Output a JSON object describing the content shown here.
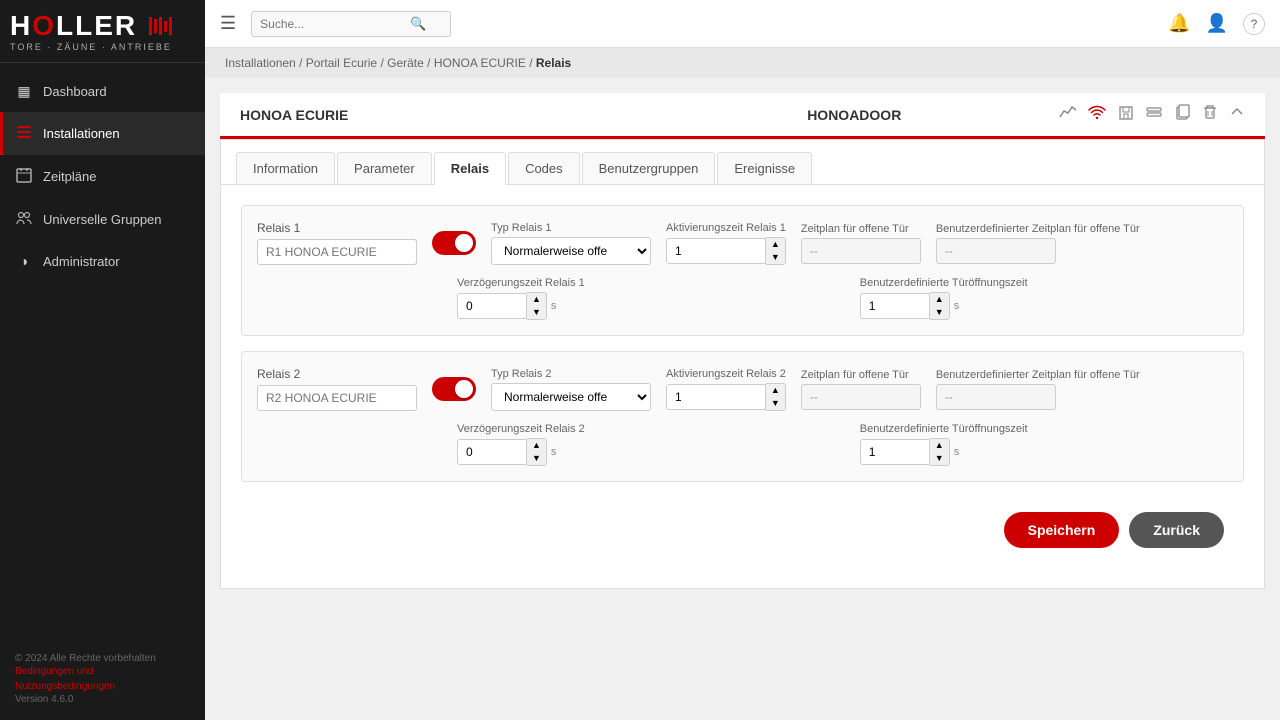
{
  "sidebar": {
    "logo_main": "HOLLER",
    "logo_sub": "TORE · ZÄUNE · ANTRIEBE",
    "nav_items": [
      {
        "id": "dashboard",
        "label": "Dashboard",
        "icon": "▦",
        "active": false
      },
      {
        "id": "installationen",
        "label": "Installationen",
        "icon": "☰",
        "active": true
      },
      {
        "id": "zeitplaene",
        "label": "Zeitpläne",
        "icon": "📅",
        "active": false
      },
      {
        "id": "universelle-gruppen",
        "label": "Universelle Gruppen",
        "icon": "👥",
        "active": false
      },
      {
        "id": "administrator",
        "label": "Administrator",
        "icon": "◑",
        "active": false
      }
    ],
    "footer": {
      "copyright": "© 2024 Alle Rechte vorbehalten",
      "terms_link": "Bedingungen und Nutzungsbedingungen",
      "version": "Version 4.6.0"
    }
  },
  "topbar": {
    "menu_icon": "☰",
    "search_placeholder": "Suche...",
    "icons": [
      "🔔",
      "👤",
      "?"
    ]
  },
  "breadcrumb": {
    "items": [
      "Installationen",
      "Portail Ecurie",
      "Geräte",
      "HONOA ECURIE"
    ],
    "current": "Relais"
  },
  "device": {
    "name_left": "HONOA ECURIE",
    "name_center": "HONOADOOR"
  },
  "tabs": [
    {
      "id": "information",
      "label": "Information",
      "active": false
    },
    {
      "id": "parameter",
      "label": "Parameter",
      "active": false
    },
    {
      "id": "relais",
      "label": "Relais",
      "active": true
    },
    {
      "id": "codes",
      "label": "Codes",
      "active": false
    },
    {
      "id": "benutzergruppen",
      "label": "Benutzergruppen",
      "active": false
    },
    {
      "id": "ereignisse",
      "label": "Ereignisse",
      "active": false
    }
  ],
  "relays": [
    {
      "id": "relay1",
      "title": "Relais 1",
      "name_placeholder": "R1 HONOA ECURIE",
      "toggle_on": true,
      "typ_label": "Typ Relais 1",
      "typ_value": "Normalerweise offe",
      "aktivierungszeit_label": "Aktivierungszeit Relais 1",
      "aktivierungszeit_value": "1",
      "zeitplan_label": "Zeitplan für offene Tür",
      "zeitplan_value": "--",
      "benutzerdef_zeitplan_label": "Benutzerdefinierter Zeitplan für offene Tür",
      "benutzerdef_zeitplan_value": "--",
      "verzoegerungszeit_label": "Verzögerungszeit Relais 1",
      "verzoegerungszeit_value": "0",
      "verzoegerungszeit_suffix": "s",
      "benutzerdef_oeffnungszeit_label": "Benutzerdefinierte Türöffnungszeit",
      "benutzerdef_oeffnungszeit_value": "1",
      "benutzerdef_oeffnungszeit_suffix": "s"
    },
    {
      "id": "relay2",
      "title": "Relais 2",
      "name_placeholder": "R2 HONOA ECURIE",
      "toggle_on": true,
      "typ_label": "Typ Relais 2",
      "typ_value": "Normalerweise offe",
      "aktivierungszeit_label": "Aktivierungszeit Relais 2",
      "aktivierungszeit_value": "1",
      "zeitplan_label": "Zeitplan für offene Tür",
      "zeitplan_value": "--",
      "benutzerdef_zeitplan_label": "Benutzerdefinierter Zeitplan für offene Tür",
      "benutzerdef_zeitplan_value": "--",
      "verzoegerungszeit_label": "Verzögerungszeit Relais 2",
      "verzoegerungszeit_value": "0",
      "verzoegerungszeit_suffix": "s",
      "benutzerdef_oeffnungszeit_label": "Benutzerdefinierte Türöffnungszeit",
      "benutzerdef_oeffnungszeit_value": "1",
      "benutzerdef_oeffnungszeit_suffix": "s"
    }
  ],
  "buttons": {
    "save": "Speichern",
    "back": "Zurück"
  }
}
